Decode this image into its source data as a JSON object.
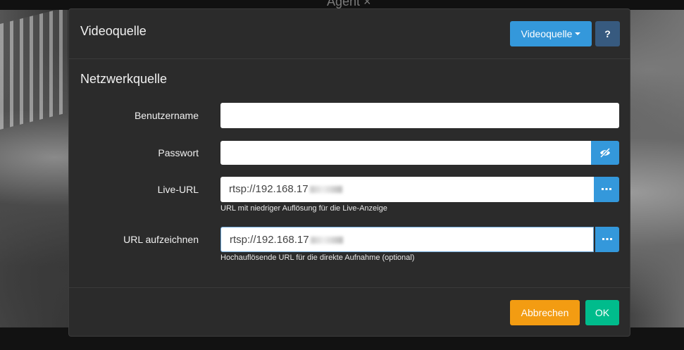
{
  "background": {
    "title": "Agent ×"
  },
  "dialog": {
    "title": "Videoquelle",
    "source_dropdown_label": "Videoquelle",
    "help_label": "?"
  },
  "section": {
    "title": "Netzwerkquelle"
  },
  "fields": {
    "username": {
      "label": "Benutzername",
      "value": ""
    },
    "password": {
      "label": "Passwort",
      "value": ""
    },
    "live_url": {
      "label": "Live-URL",
      "value": "rtsp://192.168.17",
      "help": "URL mit niedriger Auflösung für die Live-Anzeige"
    },
    "record_url": {
      "label": "URL aufzeichnen",
      "value": "rtsp://192.168.17",
      "help": "Hochauflösende URL für die direkte Aufnahme (optional)"
    }
  },
  "footer": {
    "cancel_label": "Abbrechen",
    "ok_label": "OK"
  },
  "colors": {
    "primary": "#3498db",
    "warning": "#f39c12",
    "success": "#00bc8c",
    "dark_button": "#375a7f",
    "modal_bg": "#2b2b2b"
  },
  "icons": {
    "password_toggle": "eye-slash-icon",
    "browse": "ellipsis-icon"
  }
}
